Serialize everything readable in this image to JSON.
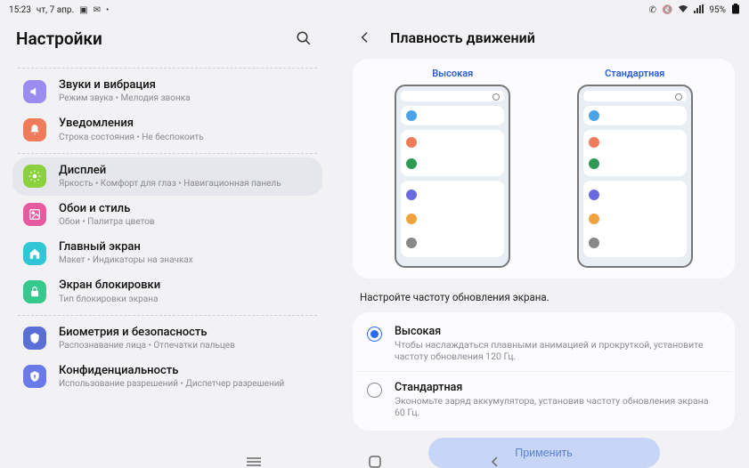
{
  "statusbar": {
    "time": "15:23",
    "date": "чт, 7 апр.",
    "battery": "95%"
  },
  "left": {
    "title": "Настройки",
    "items": [
      {
        "title": "Звуки и вибрация",
        "sub": "Режим звука  •  Мелодия звонка",
        "color": "#9b8cf0",
        "name": "sounds"
      },
      {
        "title": "Уведомления",
        "sub": "Строка состояния  •  Не беспокоить",
        "color": "#f07b5a",
        "name": "notifications"
      },
      {
        "title": "Дисплей",
        "sub": "Яркость  •  Комфорт для глаз  •  Навигационная панель",
        "color": "#8bd13e",
        "name": "display",
        "selected": true
      },
      {
        "title": "Обои и стиль",
        "sub": "Обои  •  Палитра цветов",
        "color": "#e85aa0",
        "name": "wallpaper"
      },
      {
        "title": "Главный экран",
        "sub": "Макет  •  Индикаторы на значках",
        "color": "#2fc7d6",
        "name": "home"
      },
      {
        "title": "Экран блокировки",
        "sub": "Тип блокировки экрана",
        "color": "#34c98d",
        "name": "lockscreen"
      },
      {
        "title": "Биометрия и безопасность",
        "sub": "Распознавание лица  •  Отпечатки пальцев",
        "color": "#5a6fd6",
        "name": "biometrics"
      },
      {
        "title": "Конфиденциальность",
        "sub": "Использование разрешений  •  Диспетчер разрешений",
        "color": "#6a7ae8",
        "name": "privacy"
      }
    ]
  },
  "right": {
    "title": "Плавность движений",
    "preview": {
      "high": "Высокая",
      "standard": "Стандартная"
    },
    "hint": "Настройте частоту обновления экрана.",
    "options": [
      {
        "title": "Высокая",
        "desc": "Чтобы наслаждаться плавными анимацией и прокруткой, установите частоту обновления 120 Гц.",
        "checked": true
      },
      {
        "title": "Стандартная",
        "desc": "Экономьте заряд аккумулятора, установив частоту обновления экрана 60 Гц.",
        "checked": false
      }
    ],
    "apply": "Применить"
  },
  "dots": {
    "b1": "#4aa3e8",
    "b2a": "#f07b5a",
    "b2b": "#2e9a55",
    "b3a": "#6a6ae0",
    "b3b": "#f0a23c",
    "b3c": "#888"
  }
}
